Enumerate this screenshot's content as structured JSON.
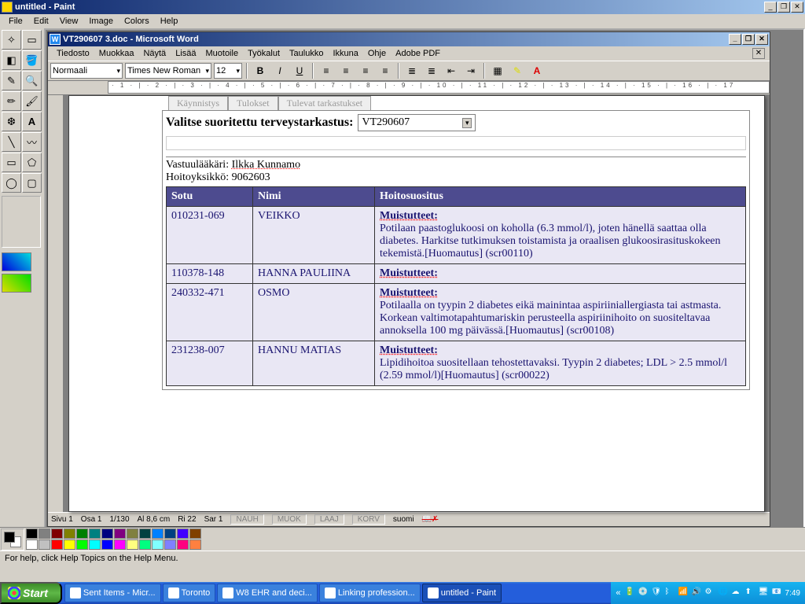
{
  "paint": {
    "title": "untitled - Paint",
    "menus": [
      "File",
      "Edit",
      "View",
      "Image",
      "Colors",
      "Help"
    ],
    "status": "For help, click Help Topics on the Help Menu.",
    "palette": [
      "#000",
      "#808080",
      "#800000",
      "#808000",
      "#008000",
      "#008080",
      "#000080",
      "#800080",
      "#808040",
      "#004040",
      "#0080ff",
      "#004080",
      "#4000ff",
      "#804000",
      "#fff",
      "#c0c0c0",
      "#f00",
      "#ff0",
      "#0f0",
      "#0ff",
      "#00f",
      "#f0f",
      "#ffff80",
      "#00ff80",
      "#80ffff",
      "#8080ff",
      "#ff0080",
      "#ff8040"
    ]
  },
  "word": {
    "title": "VT290607 3.doc - Microsoft Word",
    "menus": [
      "Tiedosto",
      "Muokkaa",
      "Näytä",
      "Lisää",
      "Muotoile",
      "Työkalut",
      "Taulukko",
      "Ikkuna",
      "Ohje",
      "Adobe PDF"
    ],
    "style": "Normaali",
    "font": "Times New Roman",
    "size": "12",
    "ruler": " · 1 · | · 2 · | · 3 · | · 4 · | · 5 · | · 6 · | · 7 · | · 8 · | · 9 · | · 10 · | · 11 · | · 12 · | · 13 · | · 14 · | · 15 · | · 16 · | · 17",
    "status": {
      "page": "Sivu  1",
      "section": "Osa  1",
      "pages": "1/130",
      "at": "Al  8,6 cm",
      "row": "Ri  22",
      "col": "Sar  1",
      "nauh": "NAUH",
      "muok": "MUOK",
      "laaj": "LAAJ",
      "korv": "KORV",
      "lang": "suomi"
    }
  },
  "doc": {
    "headerLabel": "Valitse suoritettu terveystarkastus:",
    "selectedExam": "VT290607",
    "doctorLabel": "Vastuulääkäri:",
    "doctor": "Ilkka Kunnamo",
    "unitLabel": "Hoitoyksikkö:",
    "unit": "9062603",
    "columns": {
      "sotu": "Sotu",
      "nimi": "Nimi",
      "suositus": "Hoitosuositus"
    },
    "muistLabel": "Muistutteet:",
    "rows": [
      {
        "sotu": "010231-069",
        "nimi": "VEIKKO",
        "body": "Potilaan paastoglukoosi on koholla (6.3 mmol/l), joten hänellä saattaa olla diabetes. Harkitse tutkimuksen toistamista ja oraalisen glukoosirasituskokeen tekemistä.[Huomautus] (scr00110)"
      },
      {
        "sotu": "110378-148",
        "nimi": "HANNA PAULIINA",
        "body": ""
      },
      {
        "sotu": "240332-471",
        "nimi": "OSMO",
        "body": "Potilaalla on tyypin 2 diabetes eikä mainintaa aspiriiniallergiasta tai astmasta. Korkean valtimotapahtumariskin perusteella aspiriinihoito on suositeltavaa annoksella 100 mg päivässä.[Huomautus] (scr00108)"
      },
      {
        "sotu": "231238-007",
        "nimi": "HANNU MATIAS",
        "body": "Lipidihoitoa suositellaan tehostettavaksi. Tyypin 2 diabetes; LDL > 2.5 mmol/l (2.59 mmol/l)[Huomautus] (scr00022)"
      }
    ]
  },
  "taskbar": {
    "start": "Start",
    "items": [
      {
        "label": "Sent Items - Micr...",
        "active": false
      },
      {
        "label": "Toronto",
        "active": false
      },
      {
        "label": "W8 EHR and deci...",
        "active": false
      },
      {
        "label": "Linking profession...",
        "active": false
      },
      {
        "label": "untitled - Paint",
        "active": true
      }
    ],
    "clock": "7:49"
  }
}
